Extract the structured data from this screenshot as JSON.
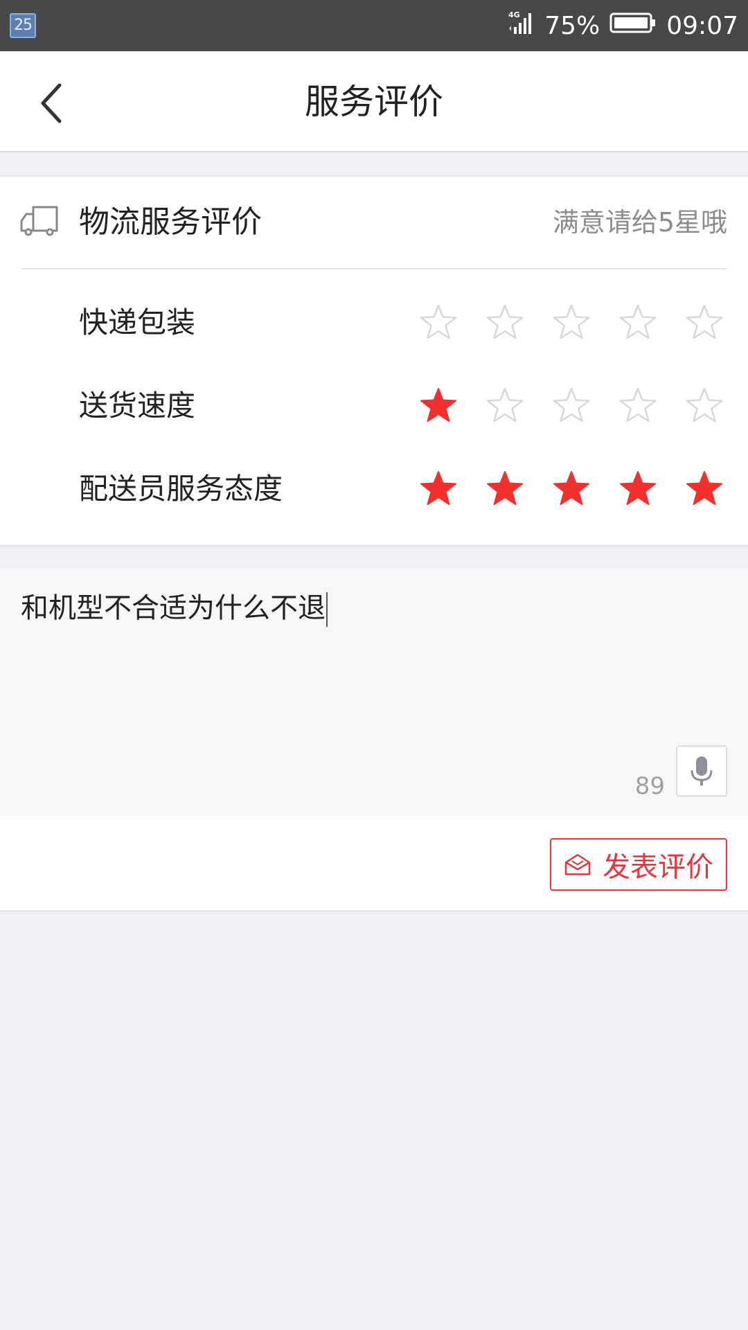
{
  "status_bar": {
    "notification": "25",
    "network": "4G",
    "battery": "75%",
    "time": "09:07"
  },
  "header": {
    "back_icon": "chevron-left-icon",
    "title": "服务评价"
  },
  "logistics": {
    "icon": "truck-icon",
    "title": "物流服务评价",
    "hint": "满意请给5星哦",
    "ratings": [
      {
        "label": "快递包装",
        "stars": 0,
        "max": 5
      },
      {
        "label": "送货速度",
        "stars": 1,
        "max": 5
      },
      {
        "label": "配送员服务态度",
        "stars": 5,
        "max": 5
      }
    ]
  },
  "comment": {
    "text": "和机型不合适为什么不退",
    "remaining": "89",
    "mic_icon": "microphone-icon"
  },
  "submit": {
    "label": "发表评价",
    "icon": "envelope-icon"
  },
  "colors": {
    "accent": "#e8343a",
    "star_on": "#f2302f",
    "star_off": "#d8d8d8",
    "status_bar": "#484848",
    "page_bg": "#f0f1f5"
  }
}
